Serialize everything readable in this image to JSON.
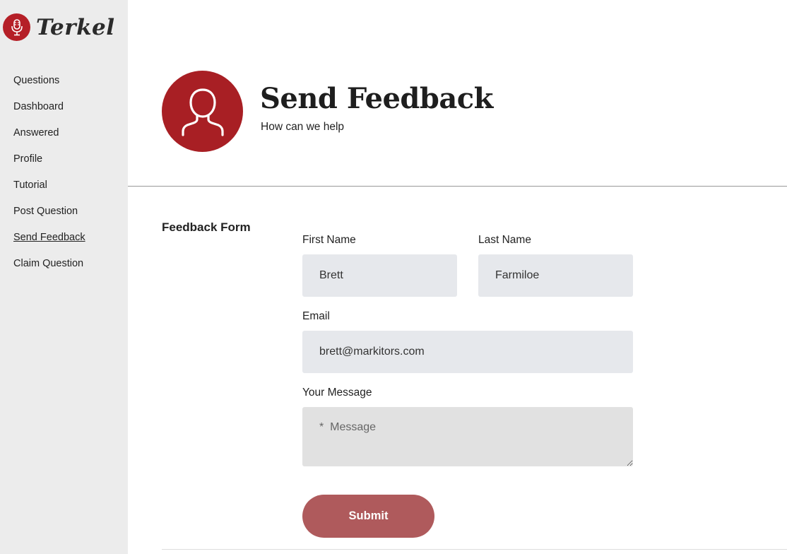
{
  "brand": {
    "name": "Terkel",
    "accent": "#b51f27"
  },
  "sidebar": {
    "items": [
      {
        "label": "Questions"
      },
      {
        "label": "Dashboard"
      },
      {
        "label": "Answered"
      },
      {
        "label": "Profile"
      },
      {
        "label": "Tutorial"
      },
      {
        "label": "Post Question"
      },
      {
        "label": "Send Feedback",
        "active": true
      },
      {
        "label": "Claim Question"
      }
    ]
  },
  "header": {
    "title": "Send Feedback",
    "subtitle": "How can we help",
    "icon": "user-icon"
  },
  "form": {
    "section_label": "Feedback Form",
    "first_name": {
      "label": "First Name",
      "value": "Brett"
    },
    "last_name": {
      "label": "Last Name",
      "value": "Farmiloe"
    },
    "email": {
      "label": "Email",
      "value": "brett@markitors.com"
    },
    "message": {
      "label": "Your Message",
      "placeholder": "*  Message",
      "value": ""
    },
    "submit_label": "Submit",
    "submit_color": "#af5a5c"
  }
}
